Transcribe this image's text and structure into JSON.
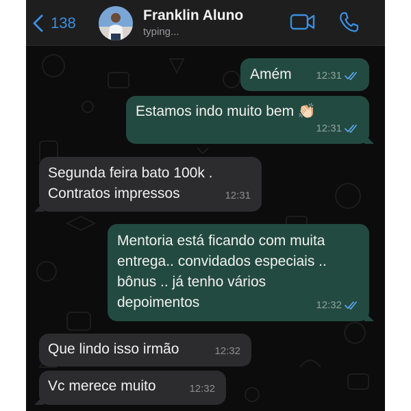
{
  "header": {
    "back_count": "138",
    "contact_name": "Franklin Aluno",
    "status": "typing..."
  },
  "messages": [
    {
      "direction": "outgoing",
      "text": "Amém",
      "time": "12:31",
      "read": true
    },
    {
      "direction": "outgoing",
      "text": "Estamos indo muito bem 👏🏻",
      "time": "12:31",
      "read": true
    },
    {
      "direction": "incoming",
      "text": "Segunda feira bato 100k .\nContratos impressos",
      "time": "12:31"
    },
    {
      "direction": "outgoing",
      "text": "Mentoria está ficando com muita\nentrega.. convidados especiais ..\nbônus .. já tenho vários\ndepoimentos",
      "time": "12:32",
      "read": true
    },
    {
      "direction": "incoming",
      "text": "Que lindo isso irmão",
      "time": "12:32"
    },
    {
      "direction": "incoming",
      "text": "Vc merece muito",
      "time": "12:32"
    }
  ],
  "icons": {
    "back": "chevron-left-icon",
    "video": "video-camera-icon",
    "call": "phone-icon",
    "read_receipt": "double-check-icon"
  },
  "colors": {
    "accent": "#3b8fe0",
    "outgoing_bubble": "#234a40",
    "incoming_bubble": "#2c2c2e",
    "background": "#0c0c0c",
    "read_tick": "#5aa2e8"
  }
}
